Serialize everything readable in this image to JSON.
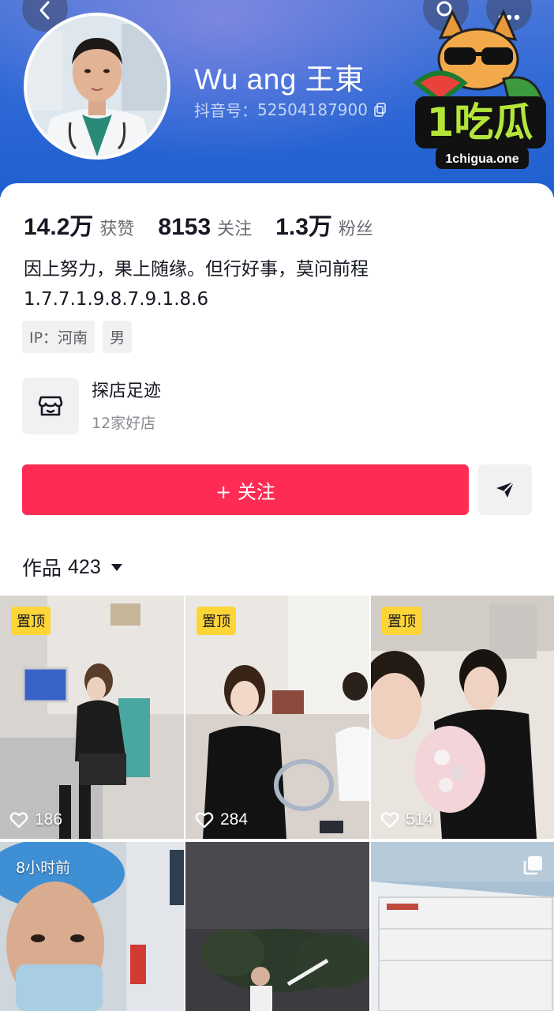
{
  "header": {
    "nickname": "Wu ang 王東",
    "douyin_id_label": "抖音号：",
    "douyin_id": "52504187900",
    "banner_color": "#2f69d6"
  },
  "watermark": {
    "logo_text": "1吃瓜",
    "domain": "1chigua.one"
  },
  "stats": [
    {
      "value": "14.2万",
      "label": "获赞"
    },
    {
      "value": "8153",
      "label": "关注"
    },
    {
      "value": "1.3万",
      "label": "粉丝"
    }
  ],
  "bio": {
    "line1": "因上努力，果上随缘。但行好事，莫问前程",
    "line2": "1.7.7.1.9.8.7.9.1.8.6"
  },
  "tags": [
    {
      "label": "IP：河南"
    },
    {
      "label": "男"
    }
  ],
  "shop": {
    "title": "探店足迹",
    "subtitle": "12家好店",
    "icon": "storefront-icon"
  },
  "actions": {
    "follow_label": "+ 关注",
    "follow_color": "#fe2c55",
    "share_icon": "paper-plane-icon"
  },
  "works": {
    "label": "作品",
    "count": "423"
  },
  "videos": [
    {
      "badge": "置顶",
      "likes": "186"
    },
    {
      "badge": "置顶",
      "likes": "284"
    },
    {
      "badge": "置顶",
      "likes": "514"
    },
    {
      "time": "8小时前"
    },
    {},
    {
      "type_icon": "multi-image-icon"
    }
  ]
}
